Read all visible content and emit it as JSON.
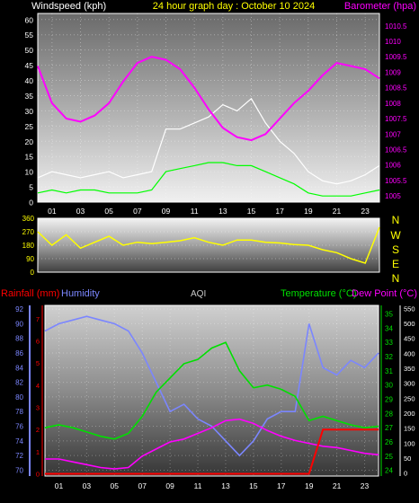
{
  "header": {
    "left_label": "Windspeed (kph)",
    "title": "24 hour graph day : October 10 2024",
    "right_label": "Barometer (hpa)"
  },
  "mid": {
    "compass": [
      "N",
      "W",
      "S",
      "E",
      "N"
    ]
  },
  "bottom_header": {
    "rain_label": "Rainfall (mm)",
    "hum_label": "Humidity",
    "aqi_label": "AQI",
    "temp_label": "Temperature (°C)",
    "dew_label": "Dew Point (°C)"
  },
  "colors": {
    "wind_gust": "#ffffff",
    "wind_avg": "#00ff00",
    "barometer": "#ff00ff",
    "direction": "#ffff00",
    "humidity": "#7b86ff",
    "temperature": "#00e000",
    "dew_point": "#ff00ff",
    "rain": "#ff0000",
    "aqi_axis": "#ffffff"
  },
  "chart_data": [
    {
      "type": "line",
      "name": "wind_baro",
      "x_ticks": [
        "01",
        "03",
        "05",
        "07",
        "09",
        "11",
        "13",
        "15",
        "17",
        "19",
        "21",
        "23"
      ],
      "xlim": [
        0,
        24
      ],
      "y_left_ticks": [
        "0",
        "5",
        "10",
        "15",
        "20",
        "25",
        "30",
        "35",
        "40",
        "45",
        "50",
        "55",
        "60"
      ],
      "ylim_left": [
        0,
        62
      ],
      "y_right_ticks": [
        "1005",
        "1005.5",
        "1006",
        "1006.5",
        "1007",
        "1007.5",
        "1008",
        "1008.5",
        "1009",
        "1009.5",
        "1010",
        "1010.5"
      ],
      "ylim_right": [
        1004.8,
        1010.9
      ],
      "series": [
        {
          "x": [
            0,
            1,
            2,
            3,
            4,
            5,
            6,
            7,
            8,
            9,
            10,
            11,
            12,
            13,
            14,
            15,
            16,
            17,
            18,
            19,
            20,
            21,
            22,
            23,
            24
          ],
          "values": [
            8,
            10,
            9,
            8,
            9,
            10,
            8,
            9,
            10,
            24,
            24,
            26,
            28,
            32,
            30,
            34,
            26,
            20,
            16,
            10,
            7,
            6,
            7,
            9,
            12
          ]
        },
        {
          "x": [
            0,
            1,
            2,
            3,
            4,
            5,
            6,
            7,
            8,
            9,
            10,
            11,
            12,
            13,
            14,
            15,
            16,
            17,
            18,
            19,
            20,
            21,
            22,
            23,
            24
          ],
          "values": [
            3,
            4,
            3,
            4,
            4,
            3,
            3,
            3,
            4,
            10,
            11,
            12,
            13,
            13,
            12,
            12,
            10,
            8,
            6,
            3,
            2,
            2,
            2,
            3,
            4
          ]
        },
        {
          "x": [
            0,
            1,
            2,
            3,
            4,
            5,
            6,
            7,
            8,
            9,
            10,
            11,
            12,
            13,
            14,
            15,
            16,
            17,
            18,
            19,
            20,
            21,
            22,
            23,
            24
          ],
          "values": [
            1009.2,
            1008,
            1007.5,
            1007.4,
            1007.6,
            1008,
            1008.7,
            1009.3,
            1009.5,
            1009.4,
            1009.1,
            1008.5,
            1007.8,
            1007.2,
            1006.9,
            1006.8,
            1007,
            1007.5,
            1008,
            1008.4,
            1008.9,
            1009.3,
            1009.2,
            1009.1,
            1008.8
          ]
        }
      ]
    },
    {
      "type": "line",
      "name": "direction",
      "y_ticks": [
        "0",
        "90",
        "180",
        "270",
        "360"
      ],
      "ylim": [
        0,
        360
      ],
      "series": [
        {
          "x": [
            0,
            1,
            2,
            3,
            4,
            5,
            6,
            7,
            8,
            9,
            10,
            11,
            12,
            13,
            14,
            15,
            16,
            17,
            18,
            19,
            20,
            21,
            22,
            23,
            24
          ],
          "values": [
            270,
            180,
            250,
            160,
            200,
            240,
            180,
            200,
            190,
            200,
            210,
            230,
            200,
            180,
            215,
            215,
            200,
            195,
            185,
            180,
            150,
            130,
            90,
            60,
            300
          ]
        }
      ]
    },
    {
      "type": "line",
      "name": "temp_hum",
      "x_ticks": [
        "01",
        "03",
        "05",
        "07",
        "09",
        "11",
        "13",
        "15",
        "17",
        "19",
        "21",
        "23"
      ],
      "xlim": [
        0,
        24
      ],
      "y_humidity_ticks": [
        "70",
        "72",
        "74",
        "76",
        "78",
        "80",
        "82",
        "84",
        "86",
        "88",
        "90",
        "92"
      ],
      "ylim_humidity": [
        69.2,
        92.5
      ],
      "y_rain_ticks": [
        "0",
        "1",
        "2",
        "3",
        "4",
        "5",
        "6",
        "7"
      ],
      "ylim_rain": [
        -0.1,
        7.6
      ],
      "y_temp_ticks": [
        "24",
        "25",
        "26",
        "27",
        "28",
        "29",
        "30",
        "31",
        "32",
        "33",
        "34",
        "35"
      ],
      "ylim_temp": [
        23.6,
        35.6
      ],
      "y_aqi_ticks": [
        "0",
        "50",
        "100",
        "150",
        "200",
        "250",
        "300",
        "350",
        "400",
        "450",
        "500",
        "550"
      ],
      "ylim_aqi": [
        -10,
        560
      ],
      "series": [
        {
          "x": [
            0,
            1,
            2,
            3,
            4,
            5,
            6,
            7,
            8,
            9,
            10,
            11,
            12,
            13,
            14,
            15,
            16,
            17,
            18,
            19,
            20,
            21,
            22,
            23,
            24
          ],
          "values": [
            89,
            90,
            90.5,
            91,
            90.5,
            90,
            89,
            86,
            82,
            78,
            79,
            77,
            76,
            74,
            72,
            74,
            77,
            78,
            78,
            90,
            84,
            83,
            85,
            84,
            86
          ]
        },
        {
          "x": [
            0,
            1,
            2,
            3,
            4,
            5,
            6,
            7,
            8,
            9,
            10,
            11,
            12,
            13,
            14,
            15,
            16,
            17,
            18,
            19,
            20,
            21,
            22,
            23,
            24
          ],
          "values": [
            27,
            27.2,
            27,
            26.7,
            26.4,
            26.2,
            26.6,
            27.8,
            29.5,
            30.5,
            31.5,
            31.8,
            32.6,
            33,
            31,
            29.8,
            30,
            29.7,
            29.2,
            27.5,
            27.8,
            27.5,
            27.2,
            27,
            27.1
          ]
        },
        {
          "x": [
            0,
            1,
            2,
            3,
            4,
            5,
            6,
            7,
            8,
            9,
            10,
            11,
            12,
            13,
            14,
            15,
            16,
            17,
            18,
            19,
            20,
            21,
            22,
            23,
            24
          ],
          "values": [
            24.8,
            24.8,
            24.6,
            24.4,
            24.2,
            24.1,
            24.2,
            25,
            25.5,
            26,
            26.2,
            26.6,
            27,
            27.5,
            27.6,
            27.3,
            26.8,
            26.4,
            26.1,
            25.9,
            25.7,
            25.6,
            25.4,
            25.2,
            25.1
          ]
        },
        {
          "x": [
            0,
            1,
            2,
            3,
            4,
            5,
            6,
            7,
            8,
            9,
            10,
            11,
            12,
            13,
            14,
            15,
            16,
            17,
            18,
            19,
            20,
            21,
            22,
            23,
            24
          ],
          "values": [
            0,
            0,
            0,
            0,
            0,
            0,
            0,
            0,
            0,
            0,
            0,
            0,
            0,
            0,
            0,
            0,
            0,
            0,
            0,
            0,
            2,
            2,
            2,
            2,
            2
          ]
        }
      ]
    }
  ]
}
